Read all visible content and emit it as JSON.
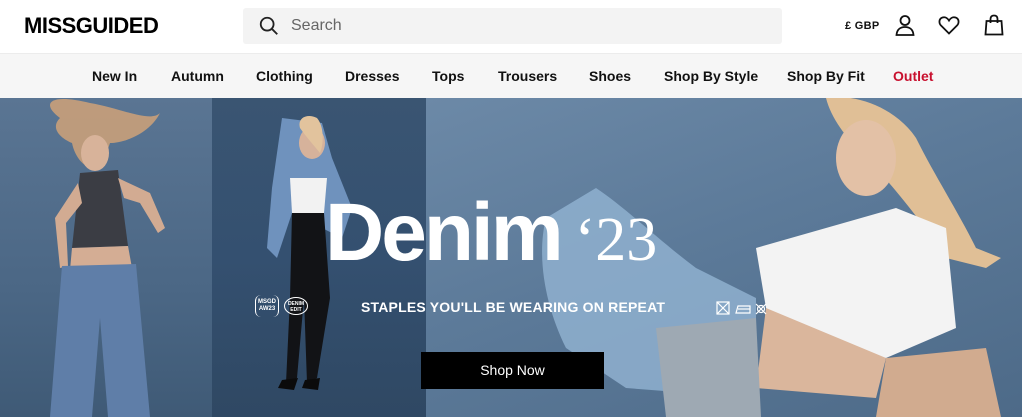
{
  "header": {
    "logo": "MISSGUIDED",
    "search_placeholder": "Search",
    "currency": "£ GBP"
  },
  "nav": {
    "items": [
      "New In",
      "Autumn",
      "Clothing",
      "Dresses",
      "Tops",
      "Trousers",
      "Shoes",
      "Shop By Style",
      "Shop By Fit",
      "Outlet"
    ]
  },
  "hero": {
    "title": "Denim",
    "year": "‘23",
    "badge_1": "MSGD AW23",
    "badge_2": "DENIM EDIT",
    "tagline": "STAPLES YOU'LL BE WEARING ON REPEAT",
    "cta": "Shop Now"
  },
  "colors": {
    "accent_sale": "#c8102e",
    "button_bg": "#000000",
    "hero_bg": "#4f6d8c"
  },
  "icons": [
    "search-icon",
    "account-icon",
    "wishlist-icon",
    "bag-icon",
    "care-label-icons"
  ]
}
